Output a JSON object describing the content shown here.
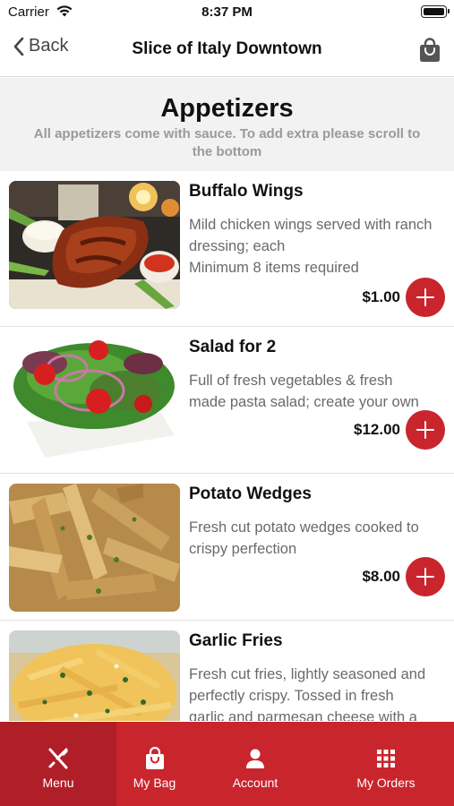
{
  "status_bar": {
    "carrier": "Carrier",
    "time": "8:37 PM"
  },
  "nav": {
    "back_label": "Back",
    "title": "Slice of Italy Downtown"
  },
  "section": {
    "title": "Appetizers",
    "subtitle": "All appetizers come with sauce. To add extra please scroll to the bottom"
  },
  "items": [
    {
      "name": "Buffalo Wings",
      "description": "Mild chicken wings served with ranch dressing; each\nMinimum 8 items required",
      "price": "$1.00"
    },
    {
      "name": "Salad for 2",
      "description": "Full of fresh vegetables & fresh made pasta salad; create your own",
      "price": "$12.00"
    },
    {
      "name": "Potato Wedges",
      "description": "Fresh cut potato wedges cooked to crispy perfection",
      "price": "$8.00"
    },
    {
      "name": "Garlic Fries",
      "description": "Fresh cut fries, lightly seasoned and perfectly crispy. Tossed in fresh garlic and parmesan cheese with a",
      "price": ""
    }
  ],
  "tabs": [
    {
      "label": "Menu",
      "icon": "fork-knife-icon",
      "active": true
    },
    {
      "label": "My Bag",
      "icon": "bag-icon",
      "active": false
    },
    {
      "label": "Account",
      "icon": "person-icon",
      "active": false
    },
    {
      "label": "My Orders",
      "icon": "grid-icon",
      "active": false
    }
  ],
  "colors": {
    "accent": "#c9252d",
    "accent_active": "#b01f27",
    "header_bg": "#f2f2f2"
  }
}
